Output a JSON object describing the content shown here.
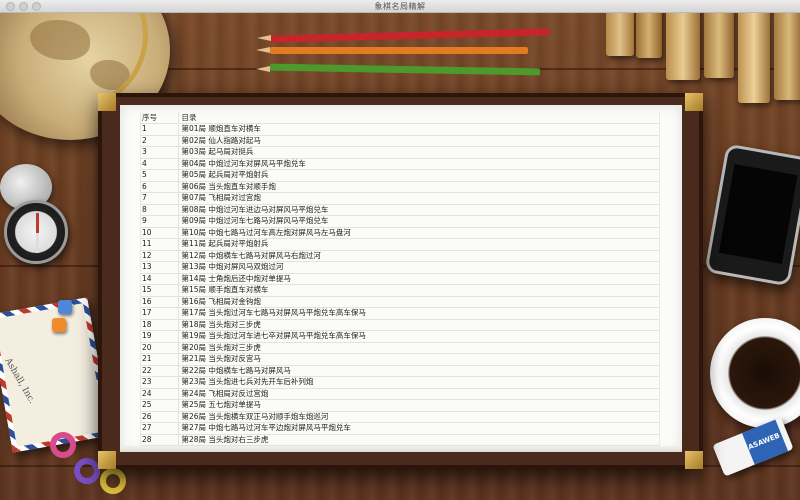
{
  "window": {
    "title": "象棋名局精解"
  },
  "toc": {
    "header_number": "序号",
    "header_title": "目录",
    "rows": [
      {
        "n": "1",
        "title": "第01局 顺炮直车对横车"
      },
      {
        "n": "2",
        "title": "第02局 仙人指路对起马"
      },
      {
        "n": "3",
        "title": "第03局 起马局对挺兵"
      },
      {
        "n": "4",
        "title": "第04局 中炮过河车对屏风马平炮兑车"
      },
      {
        "n": "5",
        "title": "第05局 起兵局对平炮射兵"
      },
      {
        "n": "6",
        "title": "第06局 当头炮直车对顺手炮"
      },
      {
        "n": "7",
        "title": "第07局 飞相局对过宫炮"
      },
      {
        "n": "8",
        "title": "第08局 中炮过河车进边马对屏风马平炮兑车"
      },
      {
        "n": "9",
        "title": "第09局 中炮过河车七路马对屏风马平炮兑车"
      },
      {
        "n": "10",
        "title": "第10局 中炮七路马过河车高左炮对屏风马左马盘河"
      },
      {
        "n": "11",
        "title": "第11局 起兵局对平炮射兵"
      },
      {
        "n": "12",
        "title": "第12局 中炮横车七路马对屏风马右炮过河"
      },
      {
        "n": "13",
        "title": "第13局 中炮对屏风马双炮过河"
      },
      {
        "n": "14",
        "title": "第14局 士角炮后还中炮对单提马"
      },
      {
        "n": "15",
        "title": "第15局 顺手炮直车对横车"
      },
      {
        "n": "16",
        "title": "第16局 飞相局对金钩炮"
      },
      {
        "n": "17",
        "title": "第17局 当头炮过河车七路马对屏风马平炮兑车高车保马"
      },
      {
        "n": "18",
        "title": "第18局 当头炮对三步虎"
      },
      {
        "n": "19",
        "title": "第19局 当头炮过河车进七卒对屏风马平炮兑车高车保马"
      },
      {
        "n": "20",
        "title": "第20局 当头炮对三步虎"
      },
      {
        "n": "21",
        "title": "第21局 当头炮对反宫马"
      },
      {
        "n": "22",
        "title": "第22局 中炮横车七路马对屏风马"
      },
      {
        "n": "23",
        "title": "第23局 当头炮进七兵对先开车后补列炮"
      },
      {
        "n": "24",
        "title": "第24局 飞相局对反过宫炮"
      },
      {
        "n": "25",
        "title": "第25局 五七炮对单提马"
      },
      {
        "n": "26",
        "title": "第26局 当头炮横车双正马对顺手炮车炮巡河"
      },
      {
        "n": "27",
        "title": "第27局 中炮七路马过河车平边炮对屏风马平炮兑车"
      },
      {
        "n": "28",
        "title": "第28局 当头炮对右三步虎"
      }
    ]
  },
  "decor": {
    "envelope_text": "Ashall, Inc.",
    "eraser_label": "ASAWEB",
    "colors": {
      "pencil_red": "#c8252a",
      "pencil_orange": "#e37a24",
      "pencil_green": "#4d9a2c",
      "book_frame": "#4a2a1c",
      "page": "#fbfbf8",
      "gold_corner": "#d4aa4c"
    }
  }
}
